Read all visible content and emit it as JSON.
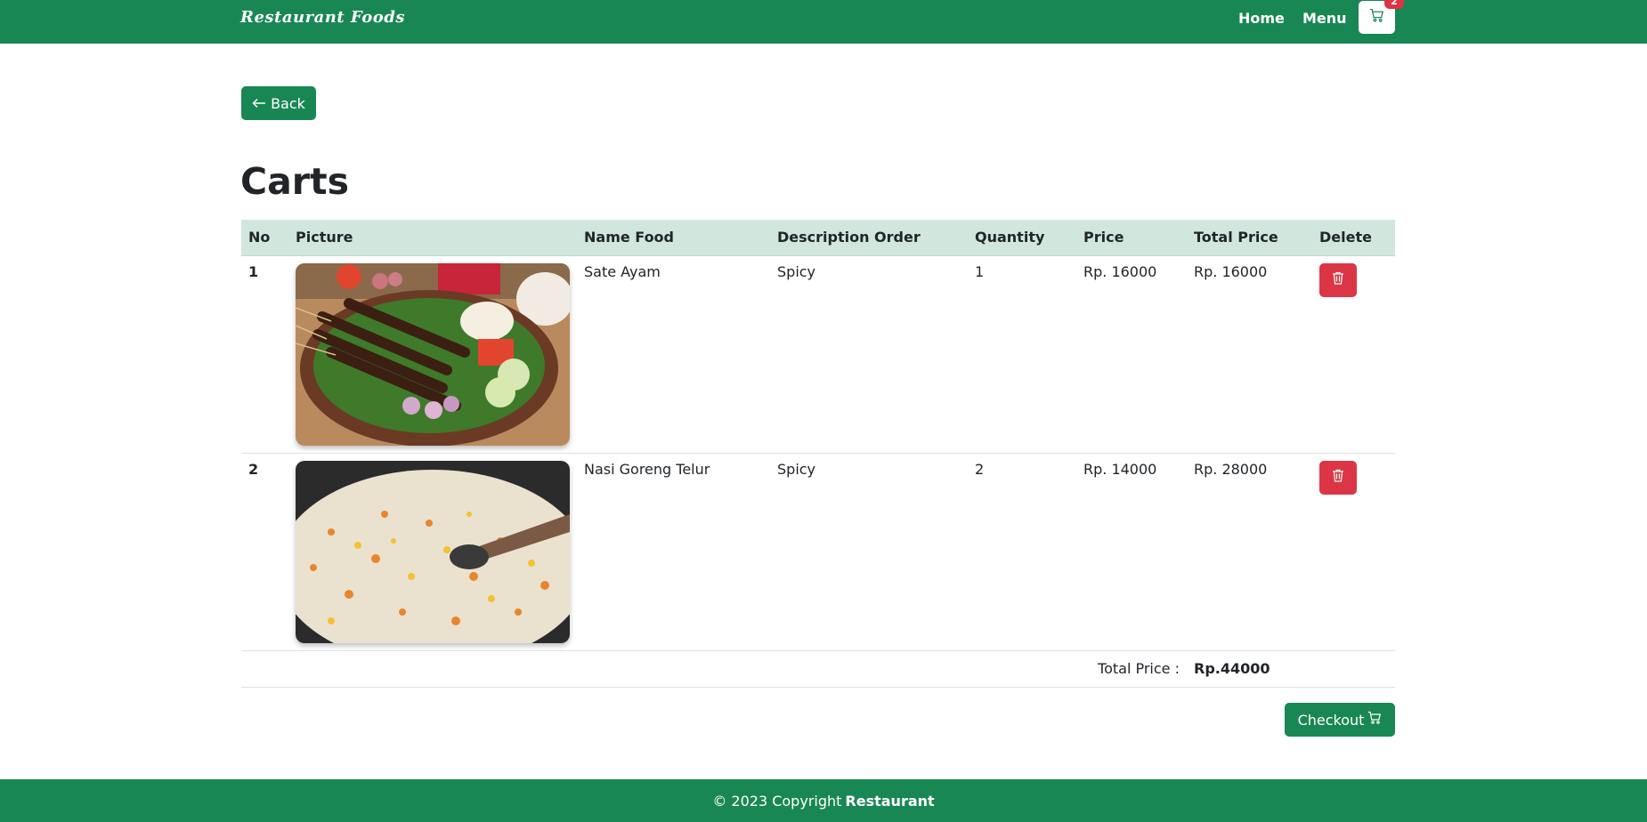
{
  "navbar": {
    "brand": "Restaurant Foods",
    "links": [
      "Home",
      "Menu"
    ],
    "cart_count": "2",
    "cart_icon": "cart-icon",
    "bg_color": "#198754"
  },
  "back_button": {
    "label": "Back",
    "icon": "arrow-left-icon"
  },
  "page": {
    "title": "Carts"
  },
  "table": {
    "headers": [
      "No",
      "Picture",
      "Name Food",
      "Description Order",
      "Quantity",
      "Price",
      "Total Price",
      "Delete"
    ],
    "rows": [
      {
        "no": "1",
        "picture": "sate-ayam-image",
        "name": "Sate Ayam",
        "description": "Spicy",
        "quantity": "1",
        "price": "Rp. 16000",
        "total": "Rp. 16000"
      },
      {
        "no": "2",
        "picture": "nasi-goreng-image",
        "name": "Nasi Goreng Telur",
        "description": "Spicy",
        "quantity": "2",
        "price": "Rp. 14000",
        "total": "Rp. 28000"
      }
    ],
    "total_label": "Total Price :",
    "total_value": "Rp.44000",
    "delete_icon": "trash-icon",
    "header_bg": "#d1e7dd"
  },
  "checkout": {
    "label": "Checkout",
    "icon": "cart-icon"
  },
  "footer": {
    "copyright": "© 2023 Copyright",
    "brand": "Restaurant"
  },
  "colors": {
    "primary": "#198754",
    "danger": "#dc3545"
  }
}
